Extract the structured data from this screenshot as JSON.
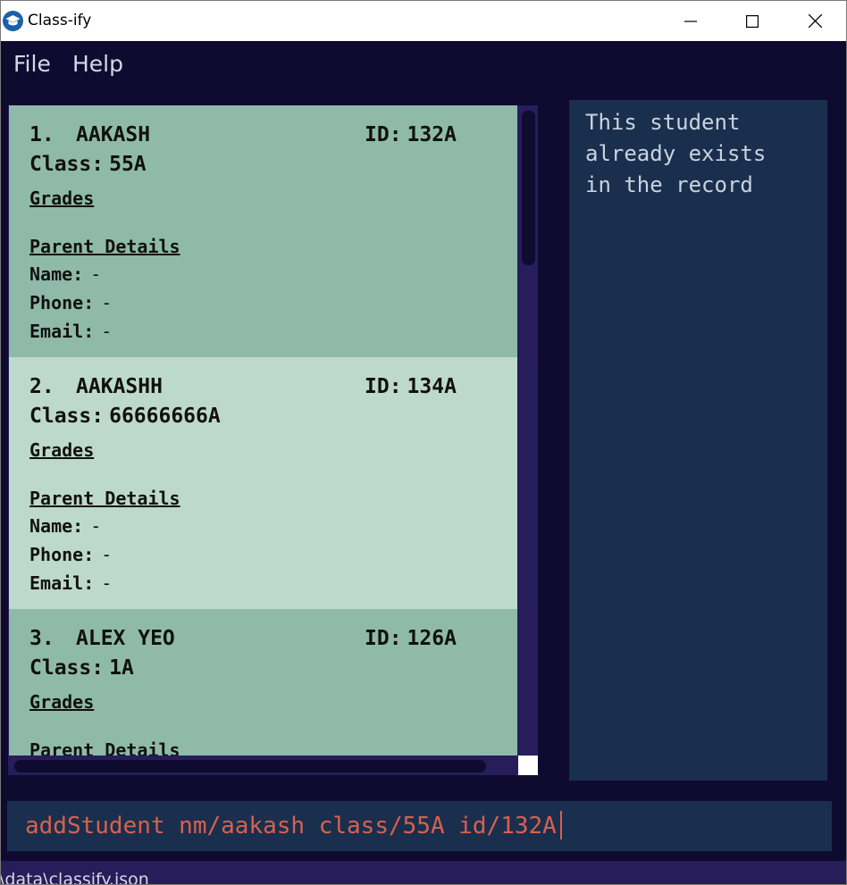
{
  "window": {
    "title": "Class-ify"
  },
  "menu": {
    "items": [
      "File",
      "Help"
    ]
  },
  "students": [
    {
      "index": "1.",
      "name": "AAKASH",
      "id_label": "ID:",
      "id": "132A",
      "class_label": "Class:",
      "class": "55A",
      "grades_label": "Grades",
      "parent_label": "Parent Details",
      "parent_name_label": "Name:",
      "parent_name": "-",
      "parent_phone_label": "Phone:",
      "parent_phone": "-",
      "parent_email_label": "Email:",
      "parent_email": "-"
    },
    {
      "index": "2.",
      "name": "AAKASHH",
      "id_label": "ID:",
      "id": "134A",
      "class_label": "Class:",
      "class": "66666666A",
      "grades_label": "Grades",
      "parent_label": "Parent Details",
      "parent_name_label": "Name:",
      "parent_name": "-",
      "parent_phone_label": "Phone:",
      "parent_phone": "-",
      "parent_email_label": "Email:",
      "parent_email": "-"
    },
    {
      "index": "3.",
      "name": "ALEX YEO",
      "id_label": "ID:",
      "id": "126A",
      "class_label": "Class:",
      "class": "1A",
      "grades_label": "Grades",
      "parent_label": "Parent Details"
    }
  ],
  "result": {
    "message": "This student\nalready exists\nin the record"
  },
  "command": {
    "value": "addStudent nm/aakash class/55A id/132A"
  },
  "status": {
    "path": "\\data\\classify.json"
  },
  "colors": {
    "background": "#0f0a30",
    "card_odd": "#8fbaaa",
    "card_even": "#bdd9cd",
    "panel": "#1a2f4e",
    "command_text": "#d9604f"
  }
}
